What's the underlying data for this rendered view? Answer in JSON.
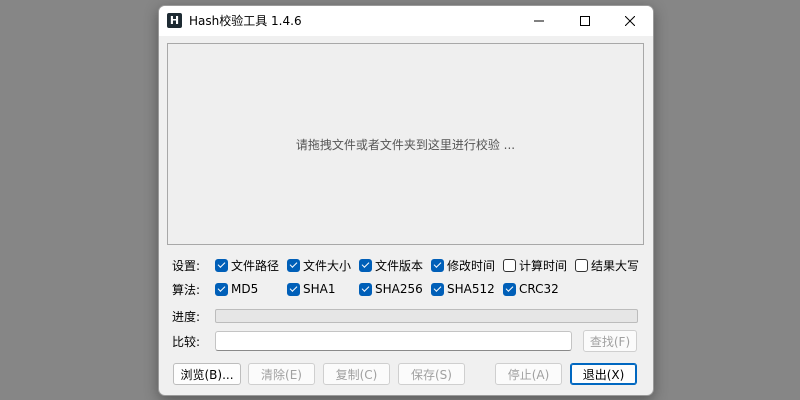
{
  "window": {
    "title": "Hash校验工具 1.4.6",
    "icon_letter": "H"
  },
  "dropzone": {
    "hint": "请拖拽文件或者文件夹到这里进行校验 ..."
  },
  "settings": {
    "label": "设置:",
    "options": [
      {
        "label": "文件路径",
        "checked": true
      },
      {
        "label": "文件大小",
        "checked": true
      },
      {
        "label": "文件版本",
        "checked": true
      },
      {
        "label": "修改时间",
        "checked": true
      },
      {
        "label": "计算时间",
        "checked": false
      },
      {
        "label": "结果大写",
        "checked": false
      }
    ]
  },
  "algorithms": {
    "label": "算法:",
    "options": [
      {
        "label": "MD5",
        "checked": true
      },
      {
        "label": "SHA1",
        "checked": true
      },
      {
        "label": "SHA256",
        "checked": true
      },
      {
        "label": "SHA512",
        "checked": true
      },
      {
        "label": "CRC32",
        "checked": true
      }
    ]
  },
  "progress": {
    "label": "进度:",
    "value": 0
  },
  "compare": {
    "label": "比较:",
    "value": "",
    "find_button": "查找(F)"
  },
  "buttons": {
    "browse": "浏览(B)...",
    "clear": "清除(E)",
    "copy": "复制(C)",
    "save": "保存(S)",
    "stop": "停止(A)",
    "exit": "退出(X)"
  },
  "icons": {
    "app": "hash-app-icon",
    "minimize": "minimize-icon",
    "maximize": "maximize-icon",
    "close": "close-icon"
  },
  "colors": {
    "accent": "#005fb8",
    "background": "#f0f0f0"
  }
}
